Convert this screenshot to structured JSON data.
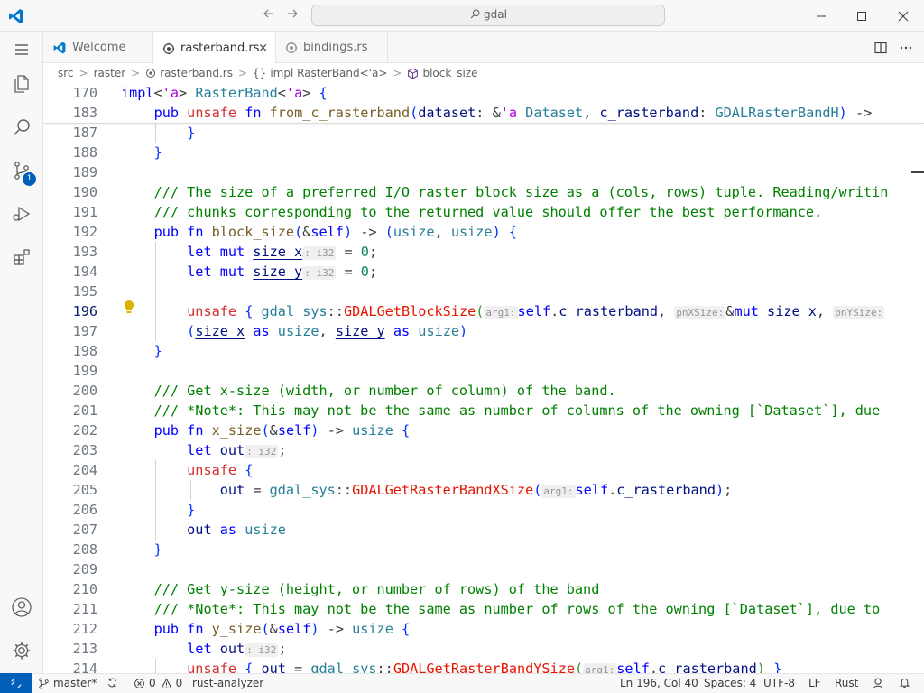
{
  "titlebar": {
    "search_text": "gdal"
  },
  "activity": {
    "source_control_badge": "1"
  },
  "tabs": [
    {
      "label": "Welcome",
      "active": false
    },
    {
      "label": "rasterband.rs",
      "active": true,
      "close": "×"
    },
    {
      "label": "bindings.rs",
      "active": false
    }
  ],
  "breadcrumb": {
    "items": [
      "src",
      "raster",
      "rasterband.rs",
      "impl RasterBand<'a>",
      "block_size"
    ],
    "separator": ">",
    "symbol_prefix": "{}"
  },
  "editor": {
    "sticky_lines": [
      {
        "n": "170",
        "text": "impl<'a> RasterBand<'a> {"
      },
      {
        "n": "183",
        "text": "    pub unsafe fn from_c_rasterband(dataset: &'a Dataset, c_rasterband: GDALRasterBandH) ->"
      }
    ],
    "lines": [
      {
        "n": "187",
        "text": "        }"
      },
      {
        "n": "188",
        "text": "    }"
      },
      {
        "n": "189",
        "text": ""
      },
      {
        "n": "190",
        "text": "    /// The size of a preferred I/O raster block size as a (cols, rows) tuple. Reading/writin"
      },
      {
        "n": "191",
        "text": "    /// chunks corresponding to the returned value should offer the best performance."
      },
      {
        "n": "192",
        "text": "    pub fn block_size(&self) -> (usize, usize) {"
      },
      {
        "n": "193",
        "text": "        let mut size_x: i32 = 0;"
      },
      {
        "n": "194",
        "text": "        let mut size_y: i32 = 0;"
      },
      {
        "n": "195",
        "text": ""
      },
      {
        "n": "196",
        "text": "        unsafe { gdal_sys::GDALGetBlockSize(arg1: self.c_rasterband, pnXSize: &mut size_x, pnYSize:"
      },
      {
        "n": "197",
        "text": "        (size_x as usize, size_y as usize)"
      },
      {
        "n": "198",
        "text": "    }"
      },
      {
        "n": "199",
        "text": ""
      },
      {
        "n": "200",
        "text": "    /// Get x-size (width, or number of column) of the band."
      },
      {
        "n": "201",
        "text": "    /// *Note*: This may not be the same as number of columns of the owning [`Dataset`], due"
      },
      {
        "n": "202",
        "text": "    pub fn x_size(&self) -> usize {"
      },
      {
        "n": "203",
        "text": "        let out: i32;"
      },
      {
        "n": "204",
        "text": "        unsafe {"
      },
      {
        "n": "205",
        "text": "            out = gdal_sys::GDALGetRasterBandXSize(arg1: self.c_rasterband);"
      },
      {
        "n": "206",
        "text": "        }"
      },
      {
        "n": "207",
        "text": "        out as usize"
      },
      {
        "n": "208",
        "text": "    }"
      },
      {
        "n": "209",
        "text": ""
      },
      {
        "n": "210",
        "text": "    /// Get y-size (height, or number of rows) of the band"
      },
      {
        "n": "211",
        "text": "    /// *Note*: This may not be the same as number of rows of the owning [`Dataset`], due to"
      },
      {
        "n": "212",
        "text": "    pub fn y_size(&self) -> usize {"
      },
      {
        "n": "213",
        "text": "        let out: i32;"
      },
      {
        "n": "214",
        "text": "        unsafe { out = gdal_sys::GDALGetRasterBandYSize(arg1: self.c_rasterband) }"
      }
    ],
    "current_line": "196"
  },
  "statusbar": {
    "branch": "master*",
    "errors": "0",
    "warnings": "0",
    "language_server": "rust-analyzer",
    "cursor": "Ln 196, Col 40",
    "spaces": "Spaces: 4",
    "encoding": "UTF-8",
    "eol": "LF",
    "language": "Rust"
  },
  "colors": {
    "accent": "#005fb8",
    "keyword": "#0000ff",
    "comment": "#008000",
    "type": "#267f99",
    "function": "#795e26",
    "variable": "#001080",
    "number": "#098658"
  }
}
